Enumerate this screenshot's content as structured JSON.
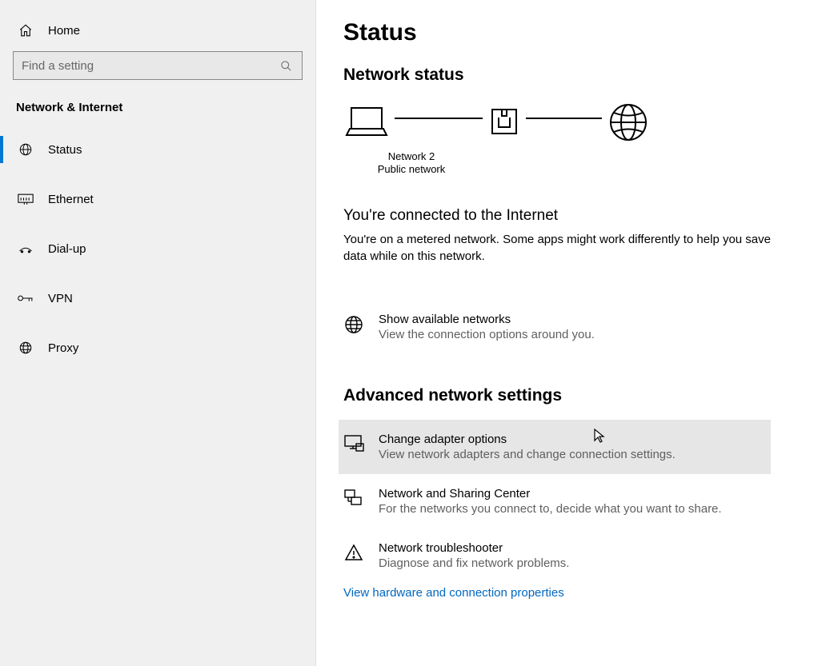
{
  "sidebar": {
    "home_label": "Home",
    "search_placeholder": "Find a setting",
    "section_heading": "Network & Internet",
    "items": [
      {
        "label": "Status",
        "selected": true
      },
      {
        "label": "Ethernet",
        "selected": false
      },
      {
        "label": "Dial-up",
        "selected": false
      },
      {
        "label": "VPN",
        "selected": false
      },
      {
        "label": "Proxy",
        "selected": false
      }
    ]
  },
  "main": {
    "title": "Status",
    "status_heading": "Network status",
    "network_name": "Network 2",
    "network_type": "Public network",
    "connected_heading": "You're connected to the Internet",
    "connected_desc": "You're on a metered network. Some apps might work differently to help you save data while on this network.",
    "show_networks": {
      "title": "Show available networks",
      "desc": "View the connection options around you."
    },
    "adv_heading": "Advanced network settings",
    "adv_items": [
      {
        "title": "Change adapter options",
        "desc": "View network adapters and change connection settings.",
        "hover": true
      },
      {
        "title": "Network and Sharing Center",
        "desc": "For the networks you connect to, decide what you want to share.",
        "hover": false
      },
      {
        "title": "Network troubleshooter",
        "desc": "Diagnose and fix network problems.",
        "hover": false
      }
    ],
    "link": "View hardware and connection properties"
  }
}
